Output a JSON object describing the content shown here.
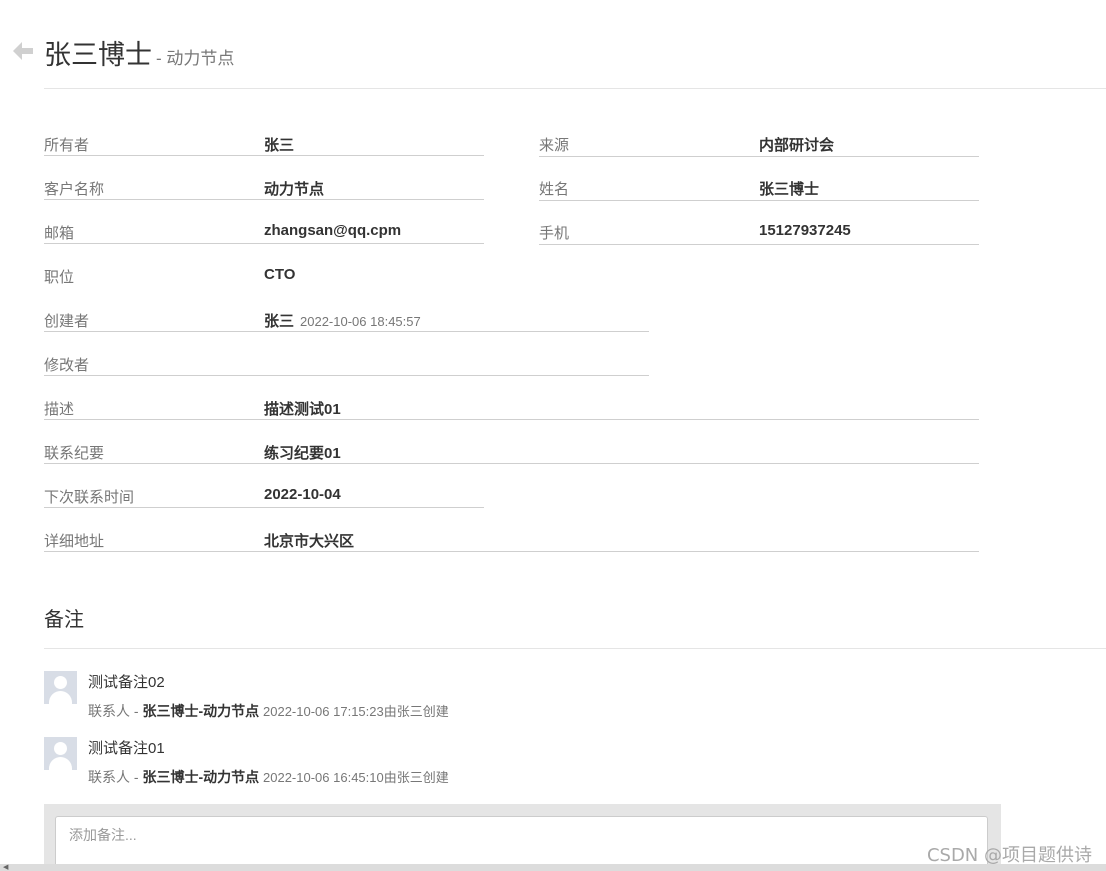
{
  "header": {
    "name": "张三博士",
    "company": "- 动力节点"
  },
  "fields": {
    "owner": {
      "label": "所有者",
      "value": "张三"
    },
    "source": {
      "label": "来源",
      "value": "内部研讨会"
    },
    "customer_name": {
      "label": "客户名称",
      "value": "动力节点"
    },
    "name": {
      "label": "姓名",
      "value": "张三博士"
    },
    "email": {
      "label": "邮箱",
      "value": "zhangsan@qq.cpm"
    },
    "mobile": {
      "label": "手机",
      "value": "15127937245"
    },
    "job": {
      "label": "职位",
      "value": "CTO"
    },
    "creator": {
      "label": "创建者",
      "value": "张三",
      "time": "2022-10-06 18:45:57"
    },
    "editor": {
      "label": "修改者",
      "value": ""
    },
    "description": {
      "label": "描述",
      "value": "描述测试01"
    },
    "contact_summary": {
      "label": "联系纪要",
      "value": "练习纪要01"
    },
    "next_contact_time": {
      "label": "下次联系时间",
      "value": "2022-10-04"
    },
    "address": {
      "label": "详细地址",
      "value": "北京市大兴区"
    }
  },
  "remarks": {
    "title": "备注",
    "items": [
      {
        "text": "测试备注02",
        "prefix": "联系人 - ",
        "contact": "张三博士-动力节点",
        "meta": "2022-10-06 17:15:23由张三创建"
      },
      {
        "text": "测试备注01",
        "prefix": "联系人 - ",
        "contact": "张三博士-动力节点",
        "meta": "2022-10-06 16:45:10由张三创建"
      }
    ],
    "input_placeholder": "添加备注..."
  },
  "watermark": "CSDN @项目题供诗",
  "icons": {
    "back": "arrow-left-icon",
    "avatar": "user-avatar-icon",
    "scroll_left": "scroll-left-arrow-icon"
  }
}
